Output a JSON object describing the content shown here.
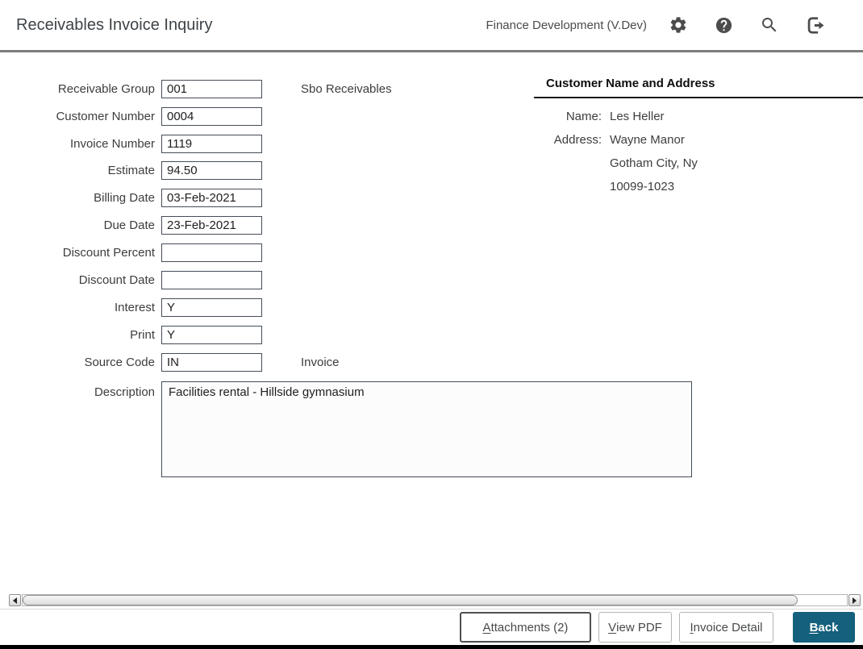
{
  "header": {
    "title": "Receivables Invoice Inquiry",
    "environment": "Finance Development (V.Dev)",
    "icons": [
      "settings-gear-icon",
      "help-icon",
      "search-icon",
      "logout-icon"
    ]
  },
  "form": {
    "fields": [
      {
        "label": "Receivable Group",
        "value": "001",
        "note": "Sbo Receivables"
      },
      {
        "label": "Customer Number",
        "value": "0004"
      },
      {
        "label": "Invoice Number",
        "value": "1119"
      },
      {
        "label": "Estimate",
        "value": "94.50"
      },
      {
        "label": "Billing Date",
        "value": "03-Feb-2021"
      },
      {
        "label": "Due Date",
        "value": "23-Feb-2021"
      },
      {
        "label": "Discount Percent",
        "value": ""
      },
      {
        "label": "Discount Date",
        "value": ""
      },
      {
        "label": "Interest",
        "value": "Y"
      },
      {
        "label": "Print",
        "value": "Y"
      },
      {
        "label": "Source Code",
        "value": "IN",
        "note": "Invoice"
      }
    ],
    "description": {
      "label": "Description",
      "value": "Facilities rental - Hillside gymnasium"
    }
  },
  "customer": {
    "section_title": "Customer Name and Address",
    "name_label": "Name:",
    "name": "Les Heller",
    "address_label": "Address:",
    "address_lines": [
      "Wayne Manor",
      "Gotham City, Ny",
      "10099-1023"
    ]
  },
  "footer": {
    "attachments": {
      "key": "A",
      "rest": "ttachments (2)"
    },
    "view_pdf": {
      "key": "V",
      "rest": "iew PDF"
    },
    "invoice_detail": {
      "key": "I",
      "rest": "nvoice Detail"
    },
    "back": {
      "key": "B",
      "rest": "ack"
    }
  },
  "colors": {
    "primary_button": "#15607c",
    "icon_gray": "#4c4c4c",
    "header_divider": "#7d7d7d",
    "input_border": "#454d57"
  }
}
